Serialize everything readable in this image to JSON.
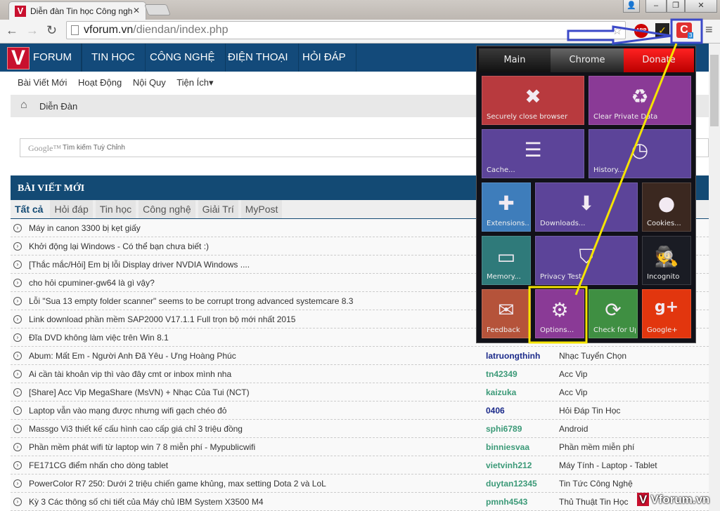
{
  "browser": {
    "tab_title": "Diễn đàn Tin học Công nghệ",
    "url_host": "vforum.vn",
    "url_path": "/diendan/index.php",
    "extension_badge": "3",
    "abp_label": "ABP"
  },
  "nav": {
    "logo_letter": "V",
    "items": [
      "FORUM",
      "TIN HỌC",
      "CÔNG NGHỆ",
      "ĐIỆN THOẠI",
      "HỎI ĐÁP"
    ]
  },
  "subnav": [
    "Bài Viết Mới",
    "Hoạt Động",
    "Nội Quy",
    "Tiện Ích▾"
  ],
  "breadcrumb": "Diễn Đàn",
  "search": {
    "brand": "Google™",
    "placeholder": "Tìm kiếm Tuỳ Chỉnh"
  },
  "block": {
    "title": "BÀI VIẾT MỚI",
    "tabs": [
      "Tất cả",
      "Hỏi đáp",
      "Tin học",
      "Công nghệ",
      "Giải Trí",
      "MyPost"
    ]
  },
  "posts": [
    {
      "title": "Máy in canon 3300 bị kẹt giấy",
      "user": "",
      "cat": ""
    },
    {
      "title": "Khởi động lại Windows - Có thể bạn chưa biết :)",
      "user": "",
      "cat": ""
    },
    {
      "title": "[Thắc mắc/Hỏi] Em bị lỗi Display driver NVDIA Windows ....",
      "user": "",
      "cat": ""
    },
    {
      "title": "cho hỏi cpuminer-gw64 là gì vậy?",
      "user": "",
      "cat": ""
    },
    {
      "title": "Lỗi \"Sua 13 empty folder scanner\" seems to be corrupt trong advanced systemcare 8.3",
      "user": "",
      "cat": ""
    },
    {
      "title": "Link download phần mềm SAP2000 V17.1.1 Full trọn bộ mới nhất 2015",
      "user": "",
      "cat": ""
    },
    {
      "title": "Đĩa DVD không làm việc trên Win 8.1",
      "user": "",
      "cat": ""
    },
    {
      "title": "Abum: Mất Em - Người Anh Đã Yêu - Ưng Hoàng Phúc",
      "user": "latruongthinh",
      "cat": "Nhạc Tuyển Chọn",
      "color": "#1b2a8a"
    },
    {
      "title": "Ai cần tài khoản vip thì vào đây cmt or inbox mình nha",
      "user": "tn42349",
      "cat": "Acc Vip",
      "color": "#3c9a78"
    },
    {
      "title": "[Share] Acc Vip MegaShare (MsVN) + Nhạc Của Tui (NCT)",
      "user": "kaizuka",
      "cat": "Acc Vip",
      "color": "#3c9a78"
    },
    {
      "title": "Laptop vẫn vào mạng được nhưng wifi gạch chéo đỏ",
      "user": "0406",
      "cat": "Hỏi Đáp Tin Học",
      "color": "#1b2a8a"
    },
    {
      "title": "Massgo Vi3 thiết kế cấu hình cao cấp giá chỉ 3 triệu đồng",
      "user": "sphi6789",
      "cat": "Android",
      "color": "#3c9a78"
    },
    {
      "title": "Phần mềm phát wifi từ laptop win 7 8 miễn phí - Mypublicwifi",
      "user": "binniesvaa",
      "cat": "Phần mềm miễn phí",
      "color": "#3c9a78"
    },
    {
      "title": "FE171CG điểm nhấn cho dòng tablet",
      "user": "vietvinh212",
      "cat": "Máy Tính - Laptop - Tablet",
      "color": "#3c9a78"
    },
    {
      "title": "PowerColor R7 250: Dưới 2 triệu chiến game khủng, max setting Dota 2 và LoL",
      "user": "duytan12345",
      "cat": "Tin Tức Công Nghệ",
      "color": "#3c9a78"
    },
    {
      "title": "Kỳ 3 Các thông số chi tiết của Máy chủ IBM System X3500 M4",
      "user": "pmnh4543",
      "cat": "Thủ Thuật Tin Học",
      "color": "#3c9a78"
    }
  ],
  "popup": {
    "tabs": [
      "Main",
      "Chrome",
      "Donate"
    ],
    "tiles": [
      {
        "label": "Securely close browser",
        "icon": "shield-x-icon",
        "glyph": "✖",
        "color": "#b83a3e"
      },
      {
        "label": "Clear Private Data",
        "icon": "recycle-icon",
        "glyph": "♻",
        "color": "#8a3a96"
      },
      {
        "label": "Cache...",
        "icon": "database-icon",
        "glyph": "☰",
        "color": "#5c4499"
      },
      {
        "label": "History...",
        "icon": "clock-icon",
        "glyph": "◷",
        "color": "#5c4499"
      },
      {
        "label": "Extensions...",
        "icon": "puzzle-icon",
        "glyph": "✚",
        "color": "#3e7dbb"
      },
      {
        "label": "Downloads...",
        "icon": "download-arrow-icon",
        "glyph": "⬇",
        "color": "#5c4499"
      },
      {
        "label": "Cookies...",
        "icon": "cookie-icon",
        "glyph": "●",
        "color": "#3b2820"
      },
      {
        "label": "Memory...",
        "icon": "memory-chip-icon",
        "glyph": "▭",
        "color": "#2f7a7a"
      },
      {
        "label": "Privacy Test",
        "icon": "shield-icon",
        "glyph": "⛉",
        "color": "#5c4499"
      },
      {
        "label": "Incognito",
        "icon": "incognito-icon",
        "glyph": "🕵",
        "color": "#1a1c24"
      },
      {
        "label": "Feedback",
        "icon": "envelope-icon",
        "glyph": "✉",
        "color": "#b5533a"
      },
      {
        "label": "Options...",
        "icon": "gear-icon",
        "glyph": "⚙",
        "color": "#8a3a96"
      },
      {
        "label": "Check for Updates",
        "icon": "refresh-icon",
        "glyph": "⟳",
        "color": "#3f8f42"
      },
      {
        "label": "Google+",
        "icon": "google-plus-icon",
        "glyph": "g+",
        "color": "#e2360e"
      }
    ]
  },
  "watermark": "Vforum.vn",
  "annotation_colors": {
    "arrow": "#3b49c8",
    "highlight": "#f5e400"
  }
}
